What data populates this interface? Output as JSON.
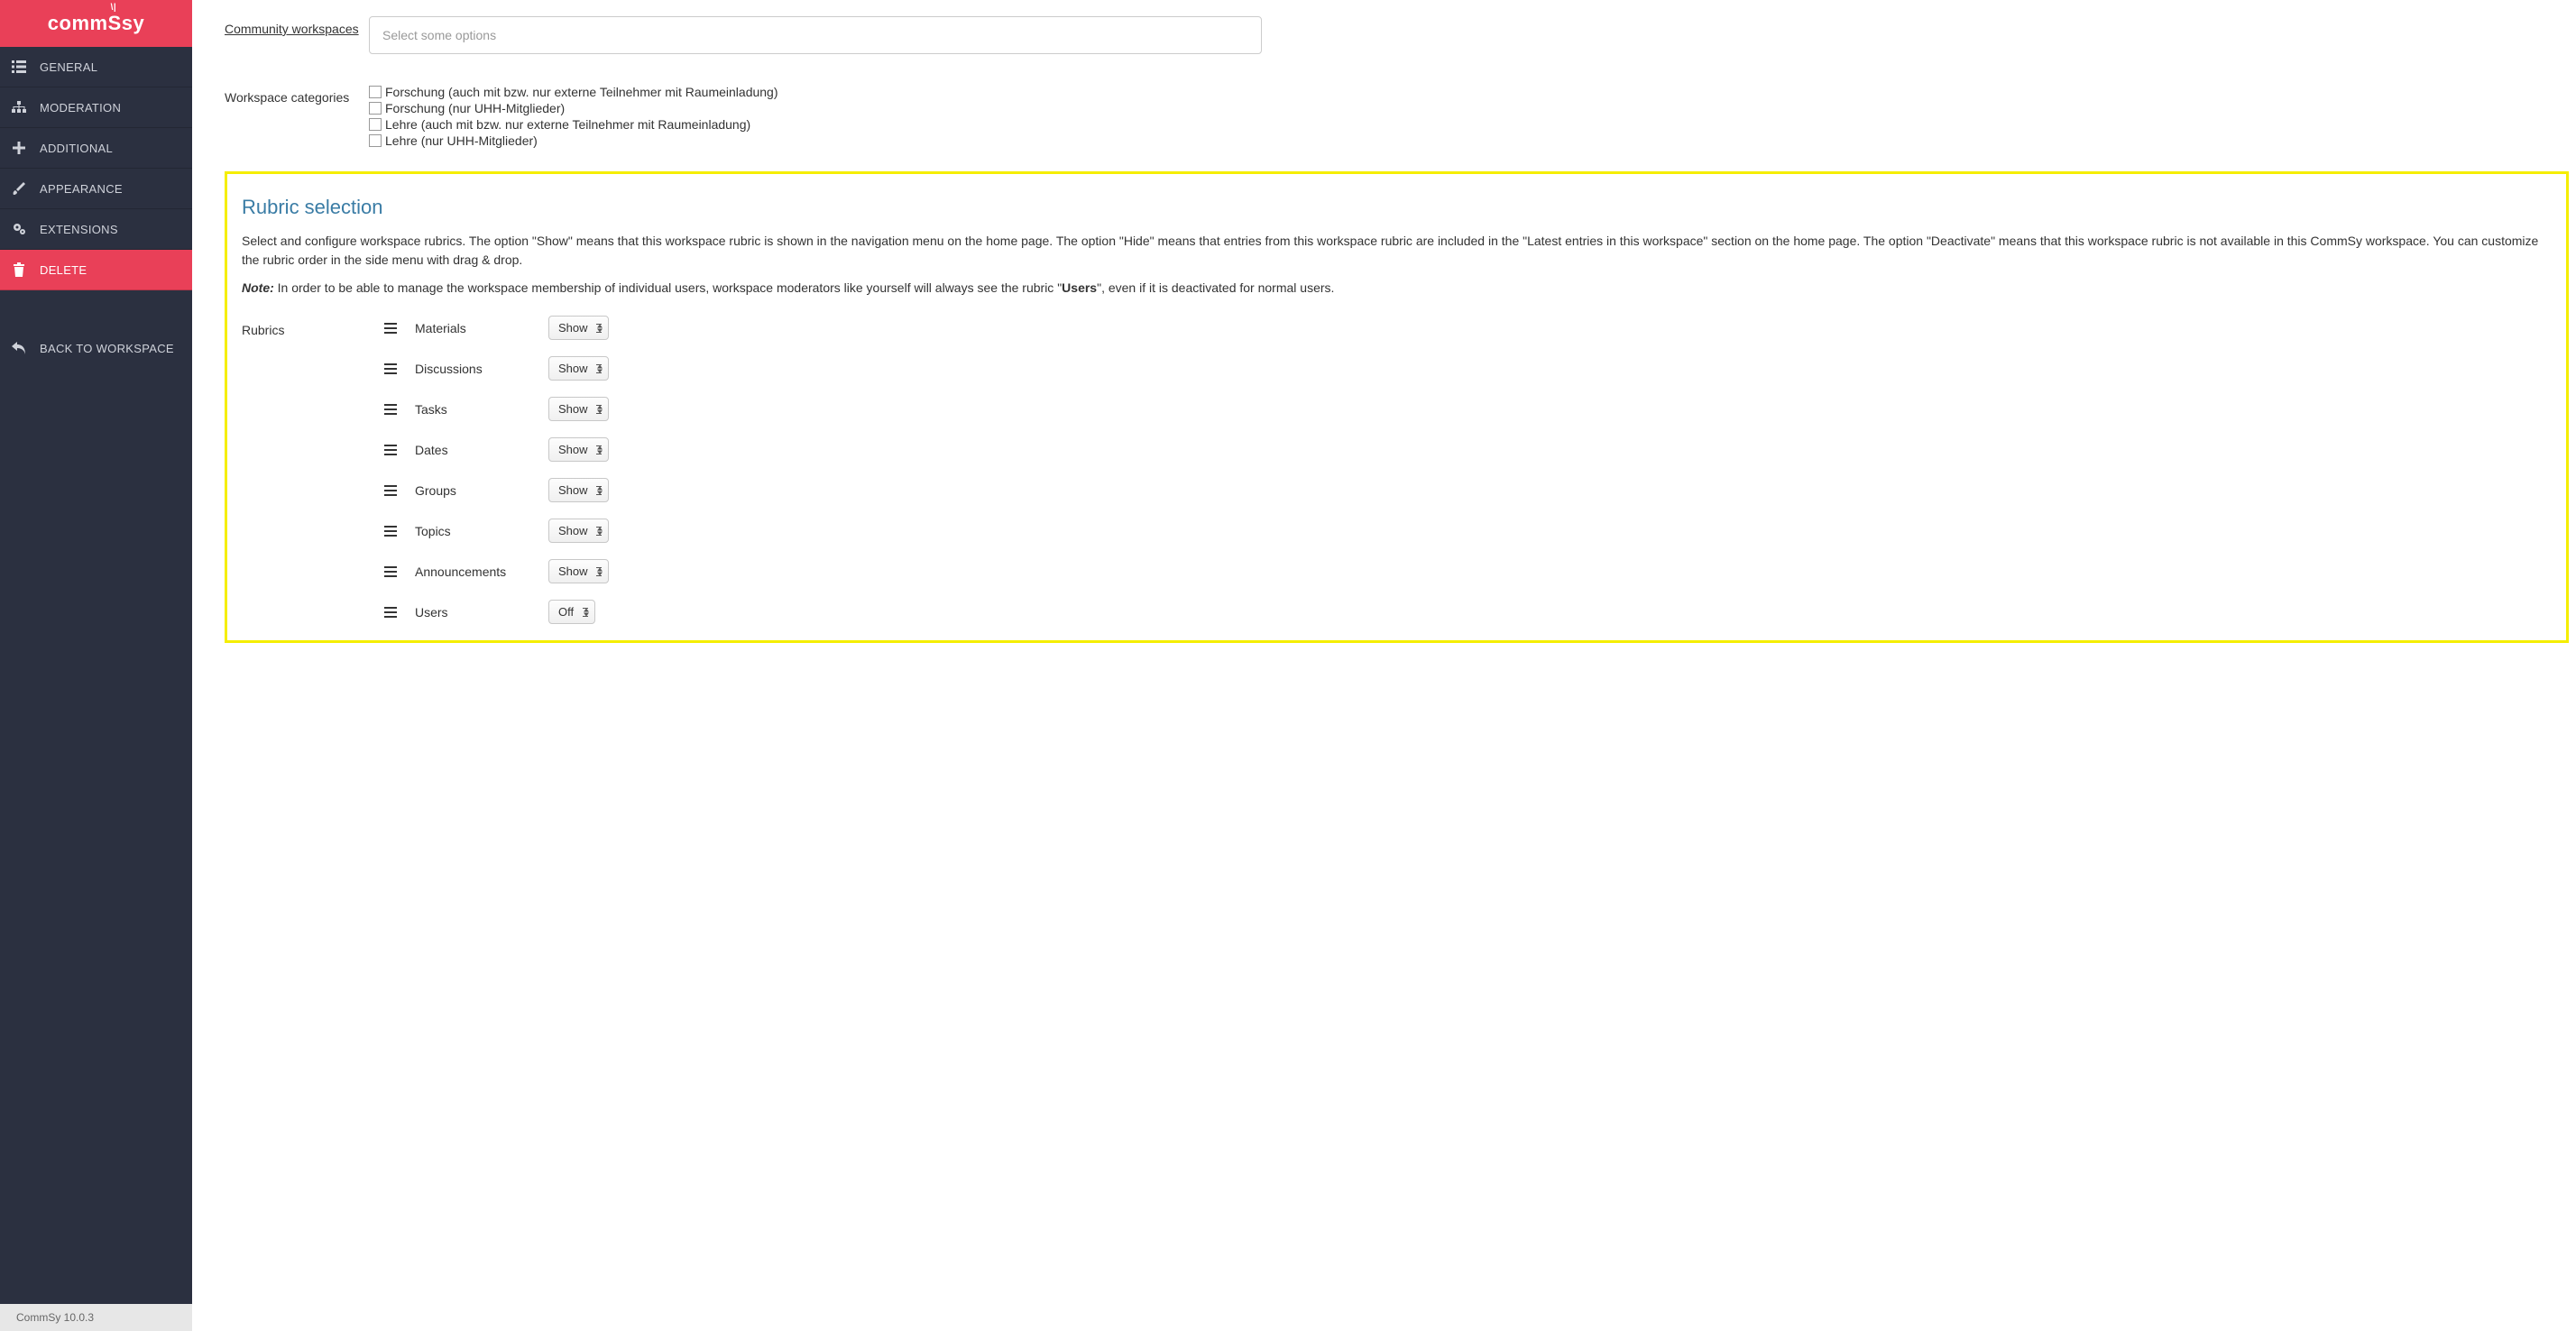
{
  "logo": "commSsy",
  "sidebar": {
    "items": [
      {
        "label": "GENERAL",
        "icon": "list-icon"
      },
      {
        "label": "MODERATION",
        "icon": "sitemap-icon"
      },
      {
        "label": "ADDITIONAL",
        "icon": "plus-icon"
      },
      {
        "label": "APPEARANCE",
        "icon": "brush-icon"
      },
      {
        "label": "EXTENSIONS",
        "icon": "gears-icon"
      },
      {
        "label": "DELETE",
        "icon": "trash-icon"
      }
    ],
    "back_label": "BACK TO WORKSPACE"
  },
  "form": {
    "community_label": "Community workspaces",
    "community_placeholder": "Select some options",
    "categories_label": "Workspace categories",
    "categories": [
      "Forschung (auch mit bzw. nur externe Teilnehmer mit Raumeinladung)",
      "Forschung (nur UHH-Mitglieder)",
      "Lehre (auch mit bzw. nur externe Teilnehmer mit Raumeinladung)",
      "Lehre (nur UHH-Mitglieder)"
    ]
  },
  "rubric_section": {
    "title": "Rubric selection",
    "description": "Select and configure workspace rubrics. The option \"Show\" means that this workspace rubric is shown in the navigation menu on the home page. The option \"Hide\" means that entries from this workspace rubric are included in the \"Latest entries in this workspace\" section on the home page. The option \"Deactivate\" means that this workspace rubric is not available in this CommSy workspace. You can customize the rubric order in the side menu with drag & drop.",
    "note_prefix": "Note:",
    "note_text_1": " In order to be able to manage the workspace membership of individual users, workspace moderators like yourself will always see the rubric \"",
    "note_bold": "Users",
    "note_text_2": "\", even if it is deactivated for normal users.",
    "rubrics_label": "Rubrics",
    "rubrics": [
      {
        "name": "Materials",
        "value": "Show"
      },
      {
        "name": "Discussions",
        "value": "Show"
      },
      {
        "name": "Tasks",
        "value": "Show"
      },
      {
        "name": "Dates",
        "value": "Show"
      },
      {
        "name": "Groups",
        "value": "Show"
      },
      {
        "name": "Topics",
        "value": "Show"
      },
      {
        "name": "Announcements",
        "value": "Show"
      },
      {
        "name": "Users",
        "value": "Off"
      }
    ]
  },
  "footer": {
    "version": "CommSy 10.0.3"
  }
}
